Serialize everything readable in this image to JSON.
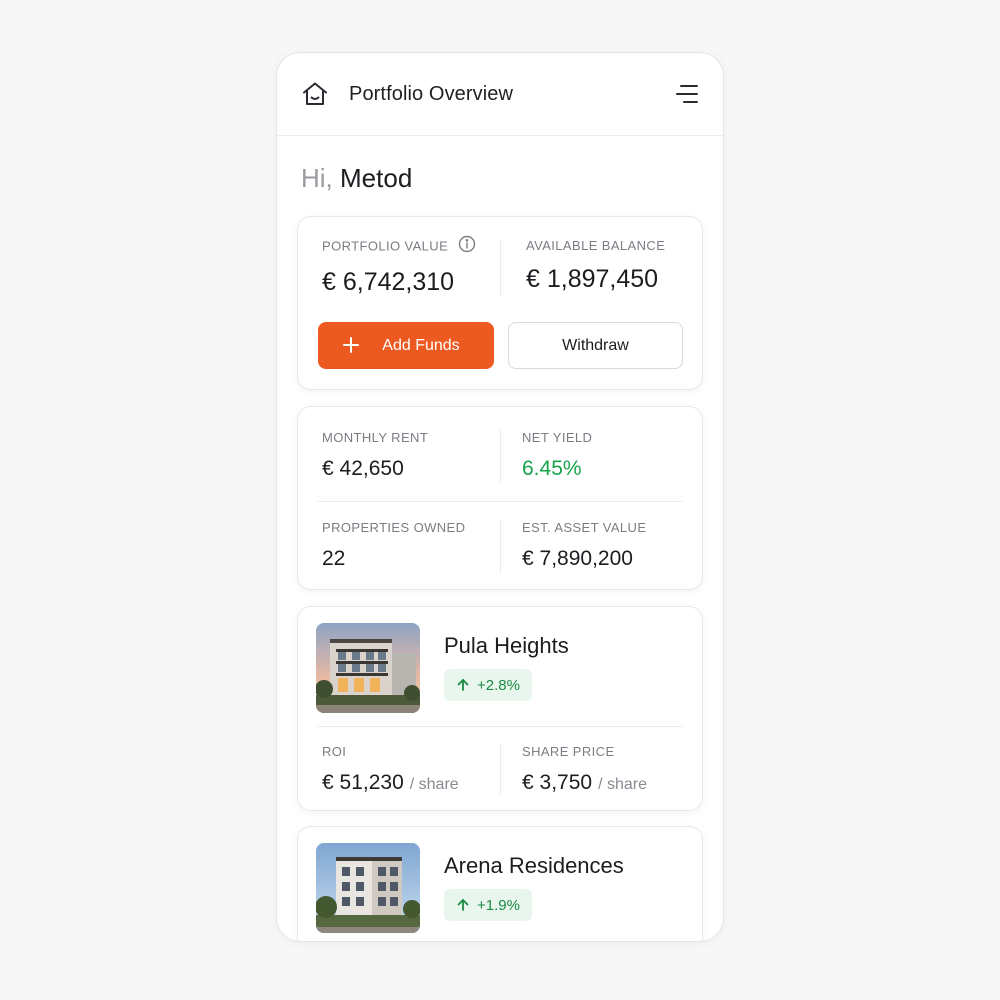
{
  "header": {
    "title": "Portfolio Overview",
    "home_icon": "home-icon",
    "menu_icon": "menu-icon"
  },
  "greeting": {
    "hi": "Hi,",
    "name": "Metod"
  },
  "balance_card": {
    "portfolio_value_label": "PORTFOLIO VALUE",
    "portfolio_value": "€ 6,742,310",
    "available_balance_label": "AVAILABLE BALANCE",
    "available_balance": "€ 1,897,450",
    "add_funds_label": "Add Funds",
    "withdraw_label": "Withdraw"
  },
  "stats_card": {
    "monthly_rent_label": "MONTHLY RENT",
    "monthly_rent": "€ 42,650",
    "net_yield_label": "NET YIELD",
    "net_yield": "6.45%",
    "properties_owned_label": "PROPERTIES OWNED",
    "properties_owned": "22",
    "est_asset_value_label": "EST. ASSET VALUE",
    "est_asset_value": "€ 7,890,200"
  },
  "properties": [
    {
      "name": "Pula Heights",
      "change": "+2.8%",
      "roi_label": "ROI",
      "roi": "€ 51,230",
      "roi_unit": "/ share",
      "share_price_label": "SHARE PRICE",
      "share_price": "€ 3,750",
      "share_price_unit": "/ share"
    },
    {
      "name": "Arena Residences",
      "change": "+1.9%"
    }
  ],
  "colors": {
    "accent": "#ec5a21",
    "positive": "#17a34a",
    "positive_bg": "#e9f6ee"
  }
}
